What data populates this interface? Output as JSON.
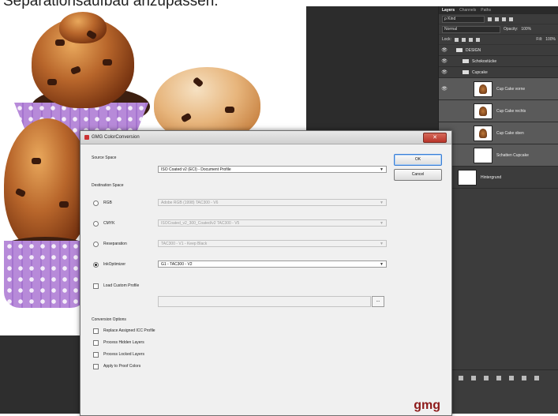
{
  "caption": "Separationsaufbau anzupassen.",
  "panel": {
    "tabs": [
      "Layers",
      "Channels",
      "Paths"
    ],
    "filter_label": "ρ Kind",
    "blend_mode": "Normal",
    "opacity_label": "Opacity:",
    "opacity_value": "100%",
    "lock_label": "Lock:",
    "fill_label": "Fill:",
    "fill_value": "100%",
    "layers": [
      {
        "name": "DESIGN",
        "kind": "group"
      },
      {
        "name": "Schokostücke",
        "kind": "group"
      },
      {
        "name": "Cupcake",
        "kind": "group"
      },
      {
        "name": "Cup Cake vorne",
        "kind": "layer"
      },
      {
        "name": "Cup Cake rechts",
        "kind": "layer"
      },
      {
        "name": "Cup Cake oben",
        "kind": "layer"
      },
      {
        "name": "Schatten Cupcake",
        "kind": "layer"
      },
      {
        "name": "Hintergrund",
        "kind": "layer"
      }
    ]
  },
  "dialog": {
    "title": "GMG ColorConversion",
    "close_glyph": "✕",
    "source_space_label": "Source Space",
    "source_space_value": "ISO Coated v2 (ECI) - Document Profile",
    "destination_space_label": "Destination Space",
    "options": [
      {
        "label": "RGB",
        "value": "Adobe RGB (1998) TAC300 - V6",
        "selected": false
      },
      {
        "label": "CMYK",
        "value": "ISOCoated_v2_300_Coated/v2 TAC300 - V5",
        "selected": false
      },
      {
        "label": "Reseparation",
        "value": "TAC300 - V1 - Keep Black",
        "selected": false
      },
      {
        "label": "InkOptimizer",
        "value": "G1 - TAC300 - V2",
        "selected": true
      }
    ],
    "load_custom_profile_label": "Load Custom Profile",
    "browse_glyph": "...",
    "conversion_options_label": "Conversion Options",
    "checkboxes": [
      "Replace Assigned ICC Profile",
      "Process Hidden Layers",
      "Process Locked Layers",
      "Apply to Proof Colors"
    ],
    "ok_label": "OK",
    "cancel_label": "Cancel",
    "logo_text": "gmg"
  }
}
